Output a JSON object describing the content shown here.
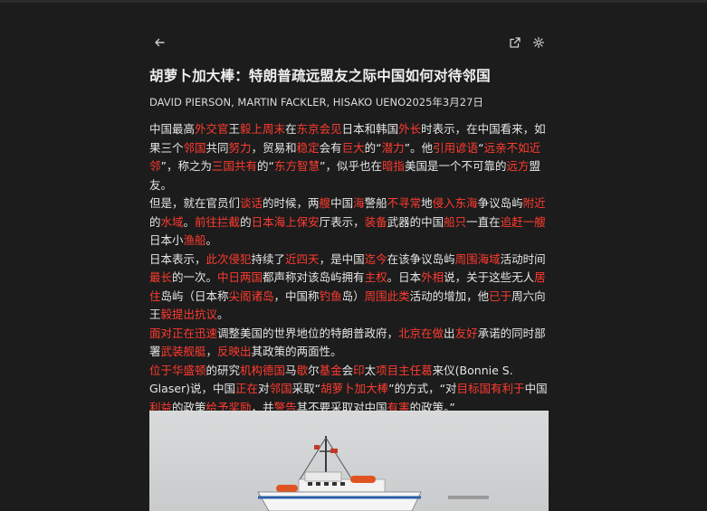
{
  "toolbar": {
    "back_icon": "arrow-left-icon",
    "open_external_icon": "open-external-icon",
    "settings_icon": "gear-icon"
  },
  "article": {
    "title": "胡萝卜加大棒：特朗普疏远盟友之际中国如何对待邻国",
    "byline": "DAVID PIERSON, MARTIN FACKLER, HISAKO UENO2025年3月27日",
    "highlight_color": "#ff3b30",
    "paragraphs": [
      [
        {
          "t": "中国最高",
          "h": false
        },
        {
          "t": "外交官",
          "h": true
        },
        {
          "t": "王",
          "h": false
        },
        {
          "t": "毅上周末",
          "h": true
        },
        {
          "t": "在",
          "h": false
        },
        {
          "t": "东京会见",
          "h": true
        },
        {
          "t": "日本和韩国",
          "h": false
        },
        {
          "t": "外长",
          "h": true
        },
        {
          "t": "时表示，在中国看来，如果三个",
          "h": false
        },
        {
          "t": "邻国",
          "h": true
        },
        {
          "t": "共同",
          "h": false
        },
        {
          "t": "努力",
          "h": true
        },
        {
          "t": "，贸易和",
          "h": false
        },
        {
          "t": "稳定",
          "h": true
        },
        {
          "t": "会有",
          "h": false
        },
        {
          "t": "巨大",
          "h": true
        },
        {
          "t": "的“",
          "h": false
        },
        {
          "t": "潜力",
          "h": true
        },
        {
          "t": "”。他",
          "h": false
        },
        {
          "t": "引用谚语",
          "h": true
        },
        {
          "t": "“",
          "h": false
        },
        {
          "t": "远亲不如近邻",
          "h": true
        },
        {
          "t": "”，称之为",
          "h": false
        },
        {
          "t": "三国共有",
          "h": true
        },
        {
          "t": "的“",
          "h": false
        },
        {
          "t": "东方智慧",
          "h": true
        },
        {
          "t": "”，似乎也在",
          "h": false
        },
        {
          "t": "暗指",
          "h": true
        },
        {
          "t": "美国是一个不可靠的",
          "h": false
        },
        {
          "t": "远方",
          "h": true
        },
        {
          "t": "盟友。",
          "h": false
        }
      ],
      [
        {
          "t": "但是，就在官员们",
          "h": false
        },
        {
          "t": "谈话",
          "h": true
        },
        {
          "t": "的时候，两",
          "h": false
        },
        {
          "t": "艘",
          "h": true
        },
        {
          "t": "中国",
          "h": false
        },
        {
          "t": "海",
          "h": true
        },
        {
          "t": "警船",
          "h": false
        },
        {
          "t": "不寻常",
          "h": true
        },
        {
          "t": "地",
          "h": false
        },
        {
          "t": "侵入东海",
          "h": true
        },
        {
          "t": "争议岛屿",
          "h": false
        },
        {
          "t": "附近",
          "h": true
        },
        {
          "t": "的",
          "h": false
        },
        {
          "t": "水域",
          "h": true
        },
        {
          "t": "。",
          "h": false
        },
        {
          "t": "前往拦截",
          "h": true
        },
        {
          "t": "的",
          "h": false
        },
        {
          "t": "日本海上保安",
          "h": true
        },
        {
          "t": "厅表示，",
          "h": false
        },
        {
          "t": "装备",
          "h": true
        },
        {
          "t": "武器的中国",
          "h": false
        },
        {
          "t": "船只",
          "h": true
        },
        {
          "t": "一直在",
          "h": false
        },
        {
          "t": "追赶一艘",
          "h": true
        },
        {
          "t": "日本小",
          "h": false
        },
        {
          "t": "渔船",
          "h": true
        },
        {
          "t": "。",
          "h": false
        }
      ],
      [
        {
          "t": "日本表示，",
          "h": false
        },
        {
          "t": "此次侵犯",
          "h": true
        },
        {
          "t": "持续了",
          "h": false
        },
        {
          "t": "近四天",
          "h": true
        },
        {
          "t": "，是中国",
          "h": false
        },
        {
          "t": "迄今",
          "h": true
        },
        {
          "t": "在该争议岛屿",
          "h": false
        },
        {
          "t": "周围海域",
          "h": true
        },
        {
          "t": "活动时间",
          "h": false
        },
        {
          "t": "最长",
          "h": true
        },
        {
          "t": "的一次。",
          "h": false
        },
        {
          "t": "中日两国",
          "h": true
        },
        {
          "t": "都声称对该岛屿拥有",
          "h": false
        },
        {
          "t": "主权",
          "h": true
        },
        {
          "t": "。日本",
          "h": false
        },
        {
          "t": "外相",
          "h": true
        },
        {
          "t": "说，关于这些无人",
          "h": false
        },
        {
          "t": "居住",
          "h": true
        },
        {
          "t": "岛屿（日本称",
          "h": false
        },
        {
          "t": "尖阁诸岛",
          "h": true
        },
        {
          "t": "，中国称",
          "h": false
        },
        {
          "t": "钓鱼",
          "h": true
        },
        {
          "t": "岛）",
          "h": false
        },
        {
          "t": "周围此类",
          "h": true
        },
        {
          "t": "活动的增加，他",
          "h": false
        },
        {
          "t": "已于",
          "h": true
        },
        {
          "t": "周六向王",
          "h": false
        },
        {
          "t": "毅提出抗议",
          "h": true
        },
        {
          "t": "。",
          "h": false
        }
      ],
      [
        {
          "t": "面对正在迅速",
          "h": true
        },
        {
          "t": "调整美国的世界地位的特朗普政府，",
          "h": false
        },
        {
          "t": "北京在做",
          "h": true
        },
        {
          "t": "出",
          "h": false
        },
        {
          "t": "友好",
          "h": true
        },
        {
          "t": "承诺的同时部署",
          "h": false
        },
        {
          "t": "武装舰艇",
          "h": true
        },
        {
          "t": "，",
          "h": false
        },
        {
          "t": "反映出",
          "h": true
        },
        {
          "t": "其政策的两面性。",
          "h": false
        }
      ],
      [
        {
          "t": "位于华盛顿",
          "h": true
        },
        {
          "t": "的研究",
          "h": false
        },
        {
          "t": "机构德国",
          "h": true
        },
        {
          "t": "马",
          "h": false
        },
        {
          "t": "歇",
          "h": true
        },
        {
          "t": "尔",
          "h": false
        },
        {
          "t": "基金",
          "h": true
        },
        {
          "t": "会",
          "h": false
        },
        {
          "t": "印",
          "h": true
        },
        {
          "t": "太",
          "h": false
        },
        {
          "t": "项目主任葛",
          "h": true
        },
        {
          "t": "来仪(Bonnie S. Glaser)说，中国",
          "h": false
        },
        {
          "t": "正在",
          "h": true
        },
        {
          "t": "对",
          "h": false
        },
        {
          "t": "邻国",
          "h": true
        },
        {
          "t": "采取“",
          "h": false
        },
        {
          "t": "胡萝卜加大棒",
          "h": true
        },
        {
          "t": "”的方式，“对",
          "h": false
        },
        {
          "t": "目标国有利于",
          "h": true
        },
        {
          "t": "中国",
          "h": false
        },
        {
          "t": "利益",
          "h": true
        },
        {
          "t": "的政策",
          "h": false
        },
        {
          "t": "给予奖励",
          "h": true
        },
        {
          "t": "，并",
          "h": false
        },
        {
          "t": "警告",
          "h": true
        },
        {
          "t": "其不要采取对中国",
          "h": false
        },
        {
          "t": "有害",
          "h": true
        },
        {
          "t": "的政策。”",
          "h": false
        }
      ]
    ]
  }
}
